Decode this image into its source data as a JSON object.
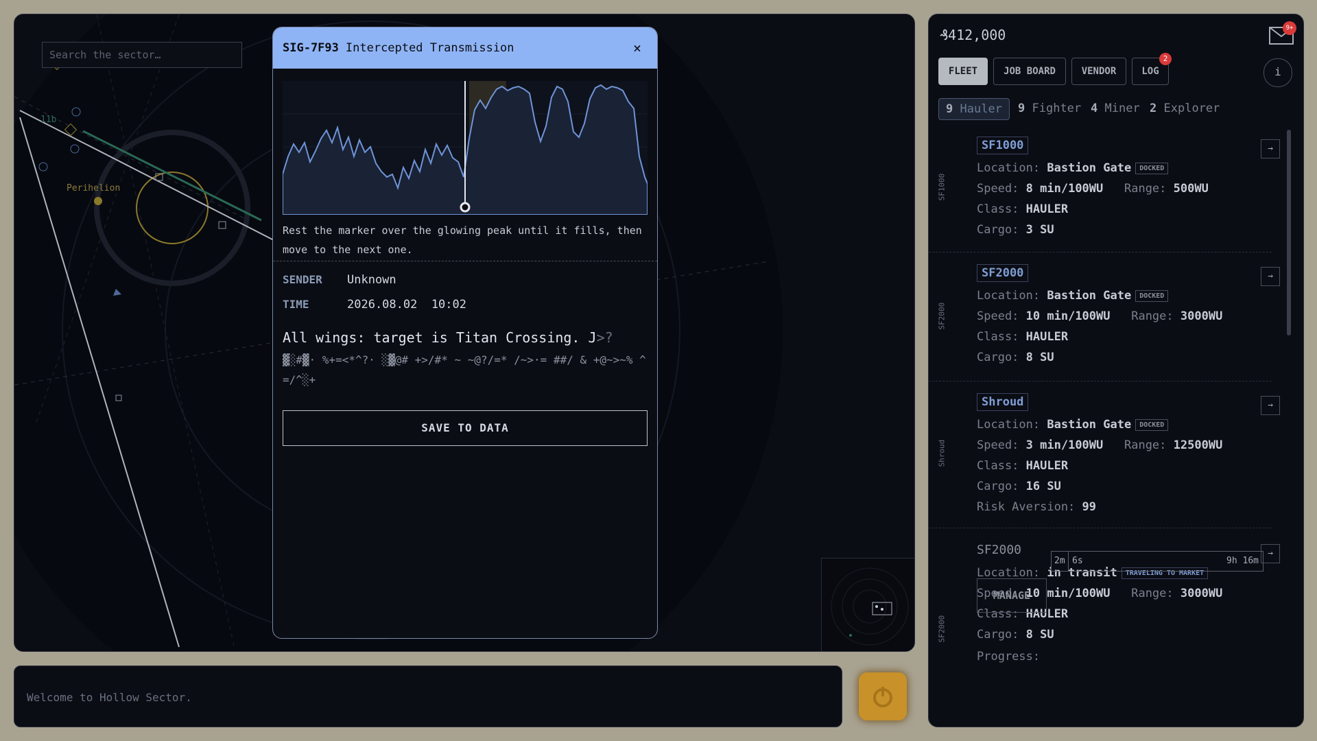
{
  "map": {
    "search_placeholder": "Search the sector…",
    "labels": {
      "planet": "Perihelion",
      "small": "11b"
    }
  },
  "modal": {
    "code": "SIG-7F93",
    "title": "Intercepted Transmission",
    "close": "×",
    "hint": "Rest the marker over the glowing peak until it fills, then move to the next one.",
    "sender_label": "SENDER",
    "sender": "Unknown",
    "time_label": "TIME",
    "time": "2026.08.02  10:02",
    "message": "All wings: target is Titan Crossing. J",
    "message_tail": ">?",
    "noise": "▓░#▓· %+=<*^?· ░▓@# +>/#* ~ ~@?/=* /~>·= ##/ & +@~>~% ^=/^░+",
    "save_label": "SAVE TO DATA"
  },
  "console": {
    "text": "Welcome to Hollow Sector."
  },
  "header": {
    "credits": "₰412,000",
    "mail_badge": "9+"
  },
  "tabs": {
    "fleet": "FLEET",
    "job_board": "JOB BOARD",
    "vendor": "VENDOR",
    "log": "LOG",
    "log_badge": "2",
    "info": "i"
  },
  "categories": [
    {
      "count": "9",
      "label": "Hauler"
    },
    {
      "count": "9",
      "label": "Fighter"
    },
    {
      "count": "4",
      "label": "Miner"
    },
    {
      "count": "2",
      "label": "Explorer"
    }
  ],
  "labels": {
    "location": "Location:",
    "speed": "Speed:",
    "range": "Range:",
    "class": "Class:",
    "cargo": "Cargo:",
    "risk": "Risk Aversion:",
    "progress": "Progress:",
    "manage": "MANAGE",
    "go": "→"
  },
  "ships": [
    {
      "side": "SF1000",
      "name": "SF1000",
      "location": "Bastion Gate",
      "status": "DOCKED",
      "speed": "8 min/100WU",
      "range": "500WU",
      "class": "HAULER",
      "cargo": "3 SU"
    },
    {
      "side": "SF2000",
      "name": "SF2000",
      "location": "Bastion Gate",
      "status": "DOCKED",
      "speed": "10 min/100WU",
      "range": "3000WU",
      "class": "HAULER",
      "cargo": "8 SU"
    },
    {
      "side": "Shroud",
      "name": "Shroud",
      "location": "Bastion Gate",
      "status": "DOCKED",
      "speed": "3 min/100WU",
      "range": "12500WU",
      "class": "HAULER",
      "cargo": "16 SU",
      "risk": "99"
    },
    {
      "side": "SF2000",
      "name": "SF2000",
      "location": "in transit",
      "status": "TRAVELING TO MARKET",
      "speed": "10 min/100WU",
      "range": "3000WU",
      "class": "HAULER",
      "cargo": "8 SU",
      "progress_elapsed": "2m",
      "progress_seg": "6s",
      "progress_remaining": "9h 16m"
    }
  ]
}
